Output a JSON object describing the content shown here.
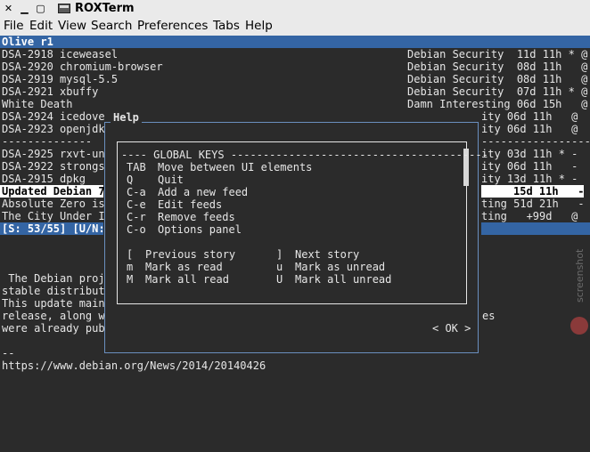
{
  "window": {
    "title": "ROXTerm"
  },
  "menu": [
    "File",
    "Edit",
    "View",
    "Search",
    "Preferences",
    "Tabs",
    "Help"
  ],
  "feed_header": "Olive r1",
  "stories": [
    {
      "left": "DSA-2918 iceweasel",
      "right": "Debian Security  11d 11h * @"
    },
    {
      "left": "DSA-2920 chromium-browser",
      "right": "Debian Security  08d 11h   @"
    },
    {
      "left": "DSA-2919 mysql-5.5",
      "right": "Debian Security  08d 11h   @"
    },
    {
      "left": "DSA-2921 xbuffy",
      "right": "Debian Security  07d 11h * @"
    },
    {
      "left": "White Death",
      "right": "Damn Interesting 06d 15h   @"
    },
    {
      "left": "DSA-2924 icedove",
      "right": "ity 06d 11h   @"
    },
    {
      "left": "DSA-2923 openjdk",
      "right": "ity 06d 11h   @"
    },
    {
      "left": "--------------",
      "right": "-------------------"
    },
    {
      "left": "DSA-2925 rxvt-un",
      "right": "ity 03d 11h * -"
    },
    {
      "left": "DSA-2922 strongs",
      "right": "ity 06d 11h   -"
    },
    {
      "left": "DSA-2915 dpkg",
      "right": "ity 13d 11h * -"
    },
    {
      "left": "Updated Debian 7",
      "right": "15d 11h   -"
    },
    {
      "left": "Absolute Zero is",
      "right": "ting 51d 21h   -"
    },
    {
      "left": "The City Under I",
      "right": "ting   +99d   @"
    }
  ],
  "status_line": "[S: 53/55] [U/N:",
  "article_lines": [
    " The Debian proj",
    "stable distribut",
    "This update main",
    "release, along w",
    "were already pub"
  ],
  "article_right_fragment": "es",
  "article_sep": "--",
  "article_url": "https://www.debian.org/News/2014/20140426",
  "help": {
    "title": "Help",
    "header": "---- GLOBAL KEYS ----------------------------------------",
    "keys": [
      {
        "key": "TAB",
        "desc": "Move between UI elements"
      },
      {
        "key": "Q",
        "desc": "Quit"
      },
      {
        "key": "C-a",
        "desc": "Add a new feed"
      },
      {
        "key": "C-e",
        "desc": "Edit feeds"
      },
      {
        "key": "C-r",
        "desc": "Remove feeds"
      },
      {
        "key": "C-o",
        "desc": "Options panel"
      }
    ],
    "pairs": [
      {
        "k1": "[",
        "d1": "Previous story",
        "k2": "]",
        "d2": "Next story"
      },
      {
        "k1": "m",
        "d1": "Mark as read",
        "k2": "u",
        "d2": "Mark as unread"
      },
      {
        "k1": "M",
        "d1": "Mark all read",
        "k2": "U",
        "d2": "Mark all unread"
      }
    ],
    "ok_label": "< OK >"
  },
  "watermark": "screenshot",
  "colors": {
    "selection": "#3465a4",
    "terminal_bg": "#2b2b2b",
    "terminal_fg": "#e6e6e6",
    "dialog_border": "#6a8fbf"
  }
}
